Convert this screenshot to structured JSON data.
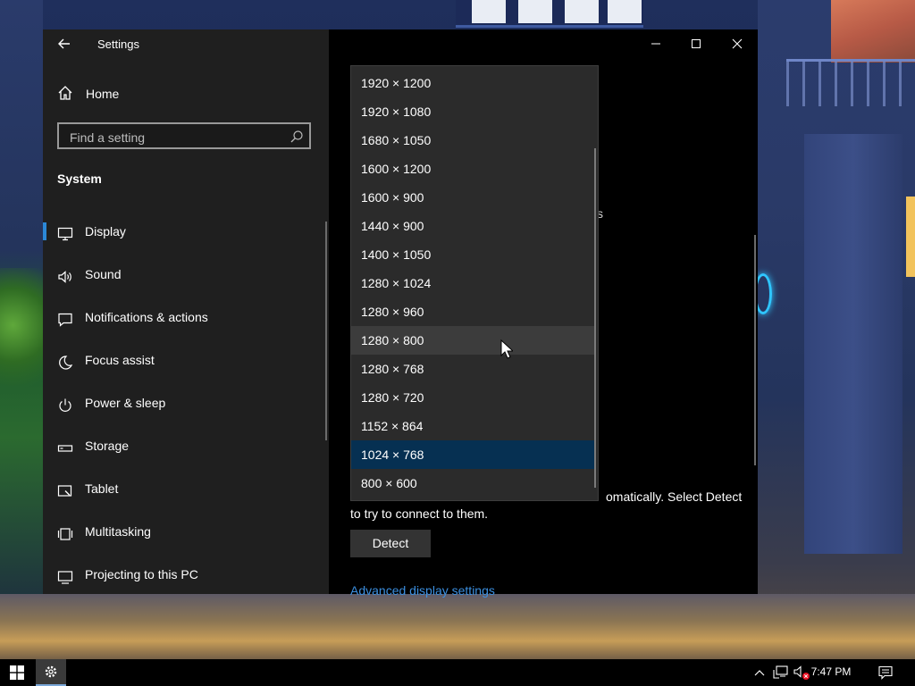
{
  "window": {
    "title": "Settings",
    "back_label": "←"
  },
  "sidebar": {
    "home_label": "Home",
    "search_placeholder": "Find a setting",
    "section_title": "System",
    "items": [
      {
        "label": "Display",
        "icon": "monitor-icon",
        "active": true
      },
      {
        "label": "Sound",
        "icon": "speaker-icon"
      },
      {
        "label": "Notifications & actions",
        "icon": "notification-icon"
      },
      {
        "label": "Focus assist",
        "icon": "moon-icon"
      },
      {
        "label": "Power & sleep",
        "icon": "power-icon"
      },
      {
        "label": "Storage",
        "icon": "storage-icon"
      },
      {
        "label": "Tablet",
        "icon": "tablet-icon"
      },
      {
        "label": "Multitasking",
        "icon": "multitasking-icon"
      },
      {
        "label": "Projecting to this PC",
        "icon": "projector-icon"
      }
    ]
  },
  "resolution_dropdown": {
    "options": [
      "1920 × 1200",
      "1920 × 1080",
      "1680 × 1050",
      "1600 × 1200",
      "1600 × 900",
      "1440 × 900",
      "1400 × 1050",
      "1280 × 1024",
      "1280 × 960",
      "1280 × 800",
      "1280 × 768",
      "1280 × 720",
      "1152 × 864",
      "1024 × 768",
      "800 × 600"
    ],
    "hovered": "1280 × 800",
    "selected": "1024 × 768"
  },
  "main": {
    "fragment_char": "s",
    "body_line1": "omatically. Select Detect",
    "body_line2": "to try to connect to them.",
    "detect_label": "Detect",
    "advanced_link": "Advanced display settings"
  },
  "taskbar": {
    "time": "7:47 PM"
  },
  "colors": {
    "accent": "#2b88d8",
    "selected_bg": "#063052",
    "hover_bg": "#3c3c3c",
    "link": "#3b8fe0"
  }
}
